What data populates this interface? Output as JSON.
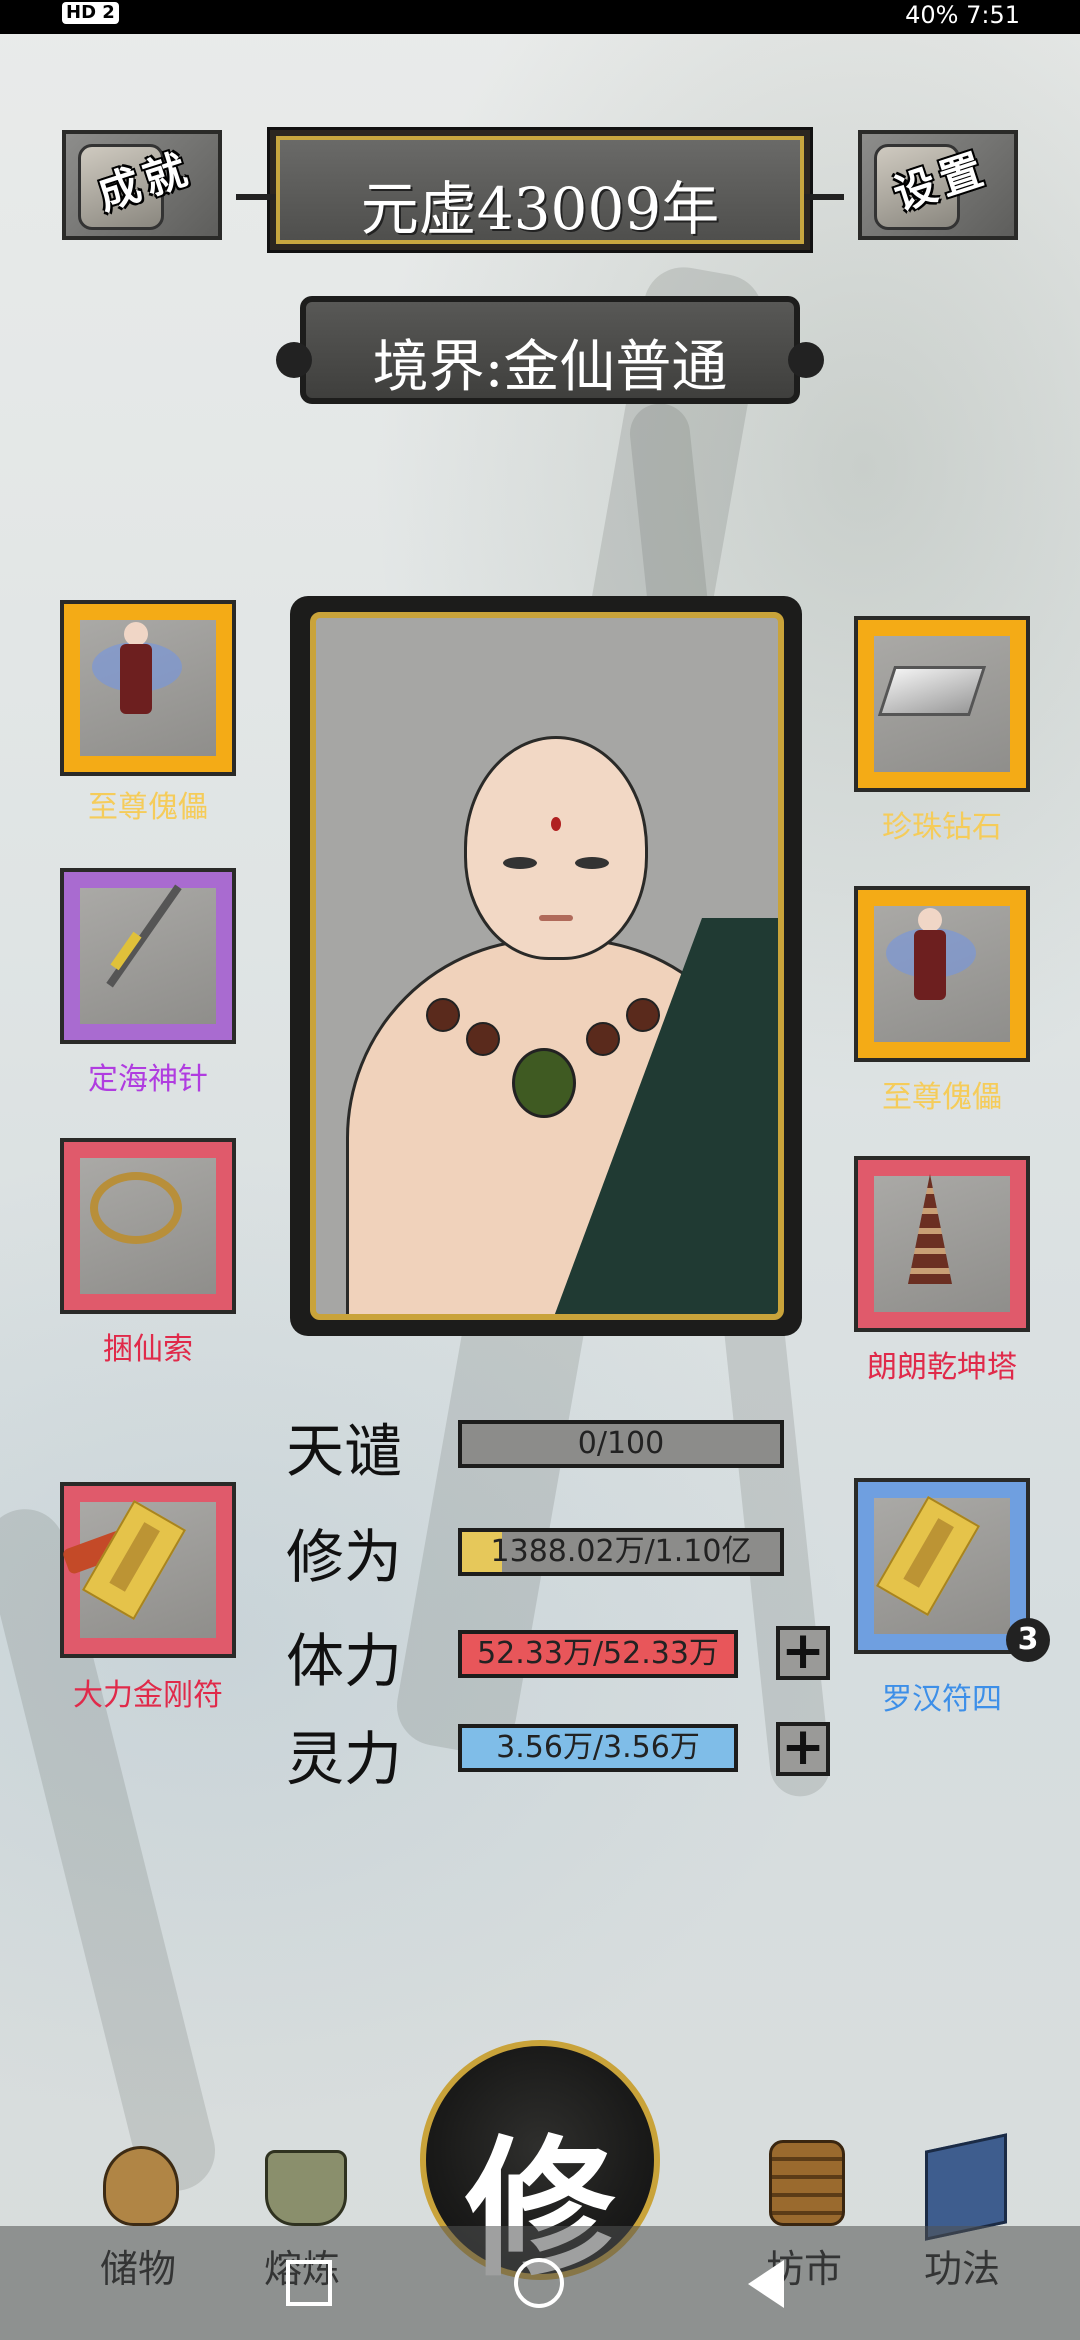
{
  "status_bar": {
    "left": "HD 2",
    "right": "40% 7:51"
  },
  "top": {
    "achievements_label": "成就",
    "settings_label": "设置",
    "year": "元虚43009年",
    "realm": "境界:金仙普通"
  },
  "left_slots": [
    {
      "name": "至尊傀儡",
      "color": "#f4ab16",
      "name_color": "#f5cc5a",
      "icon": "puppet"
    },
    {
      "name": "定海神针",
      "color": "#a96bd0",
      "name_color": "#b03ce0",
      "icon": "needle"
    },
    {
      "name": "捆仙索",
      "color": "#e05a6b",
      "name_color": "#e02a4a",
      "icon": "rope"
    },
    {
      "name": "大力金刚符",
      "color": "#e05a6b",
      "name_color": "#e02a4a",
      "icon": "talisman"
    }
  ],
  "right_slots": [
    {
      "name": "珍珠钻石",
      "color": "#f4ab16",
      "name_color": "#f5cc5a",
      "icon": "diamond"
    },
    {
      "name": "至尊傀儡",
      "color": "#f4ab16",
      "name_color": "#f5cc5a",
      "icon": "puppet"
    },
    {
      "name": "朗朗乾坤塔",
      "color": "#e05a6b",
      "name_color": "#e02a4a",
      "icon": "tower"
    },
    {
      "name": "罗汉符四",
      "color": "#6f9fe0",
      "name_color": "#3d8fe8",
      "icon": "talisman",
      "badge": "3"
    }
  ],
  "stats": {
    "tianqian": {
      "label": "天谴",
      "value": "0/100",
      "fraction": 0.0
    },
    "xiuwei": {
      "label": "修为",
      "value": "1388.02万/1.10亿",
      "fraction": 0.126,
      "fill_color": "#e6c85a"
    },
    "tili": {
      "label": "体力",
      "value": "52.33万/52.33万",
      "fraction": 1.0,
      "fill_color": "#e8565a"
    },
    "lingli": {
      "label": "灵力",
      "value": "3.56万/3.56万",
      "fraction": 1.0,
      "fill_color": "#7fbde8"
    },
    "plus_symbol": "+"
  },
  "nav": {
    "storage": "储物",
    "refine": "熔炼",
    "cultivate": "修",
    "market": "坊市",
    "skills": "功法"
  }
}
